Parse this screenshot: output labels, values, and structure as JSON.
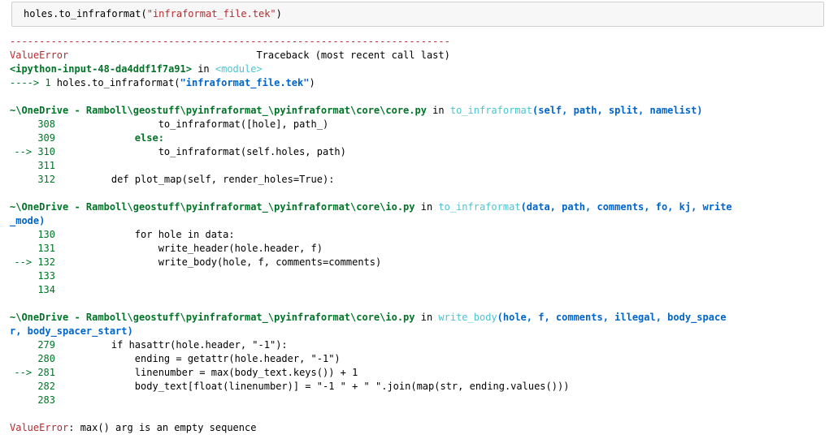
{
  "input": {
    "prefix": "holes.to_infraformat(",
    "arg": "\"infraformat_file.tek\"",
    "suffix": ")"
  },
  "traceback": {
    "separator": "---------------------------------------------------------------------------",
    "error_name": "ValueError",
    "traceback_label": "Traceback (most recent call last)",
    "frame0": {
      "location": "<ipython-input-48-da4ddf1f7a91>",
      "in_word": " in ",
      "func": "<module>",
      "arrow": "----> 1 ",
      "code_a": "holes.to_infraformat(",
      "code_str": "\"infraformat_file.tek\"",
      "code_b": ")"
    },
    "frame1": {
      "path": "~\\OneDrive - Ramboll\\geostuff\\pyinfraformat_\\pyinfraformat\\core\\core.py",
      "in_word": " in ",
      "func": "to_infraformat",
      "args": "(self, path, split, namelist)",
      "lines": [
        {
          "num": "308",
          "code": "            to_infraformat([hole], path_)"
        },
        {
          "num": "309",
          "code": "        else:"
        },
        {
          "num": "--> 310",
          "code": "            to_infraformat(self.holes, path)",
          "current": true
        },
        {
          "num": "311",
          "code": ""
        },
        {
          "num": "312",
          "code": "    def plot_map(self, render_holes=True):"
        }
      ]
    },
    "frame2": {
      "path": "~\\OneDrive - Ramboll\\geostuff\\pyinfraformat_\\pyinfraformat\\core\\io.py",
      "in_word": " in ",
      "func": "to_infraformat",
      "args_line1": "(data, path, comments, fo, kj, write",
      "args_line2": "_mode)",
      "lines": [
        {
          "num": "130",
          "code": "        for hole in data:"
        },
        {
          "num": "131",
          "code": "            write_header(hole.header, f)"
        },
        {
          "num": "--> 132",
          "code": "            write_body(hole, f, comments=comments)",
          "current": true
        },
        {
          "num": "133",
          "code": ""
        },
        {
          "num": "134",
          "code": ""
        }
      ]
    },
    "frame3": {
      "path": "~\\OneDrive - Ramboll\\geostuff\\pyinfraformat_\\pyinfraformat\\core\\io.py",
      "in_word": " in ",
      "func": "write_body",
      "args_line1": "(hole, f, comments, illegal, body_space",
      "args_line2": "r, body_spacer_start)",
      "lines": [
        {
          "num": "279",
          "code": "    if hasattr(hole.header, \"-1\"):"
        },
        {
          "num": "280",
          "code": "        ending = getattr(hole.header, \"-1\")"
        },
        {
          "num": "--> 281",
          "code": "        linenumber = max(body_text.keys()) + 1",
          "current": true
        },
        {
          "num": "282",
          "code": "        body_text[float(linenumber)] = \"-1 \" + \" \".join(map(str, ending.values()))"
        },
        {
          "num": "283",
          "code": ""
        }
      ]
    },
    "final": {
      "error_name": "ValueError",
      "message": ": max() arg is an empty sequence"
    }
  }
}
